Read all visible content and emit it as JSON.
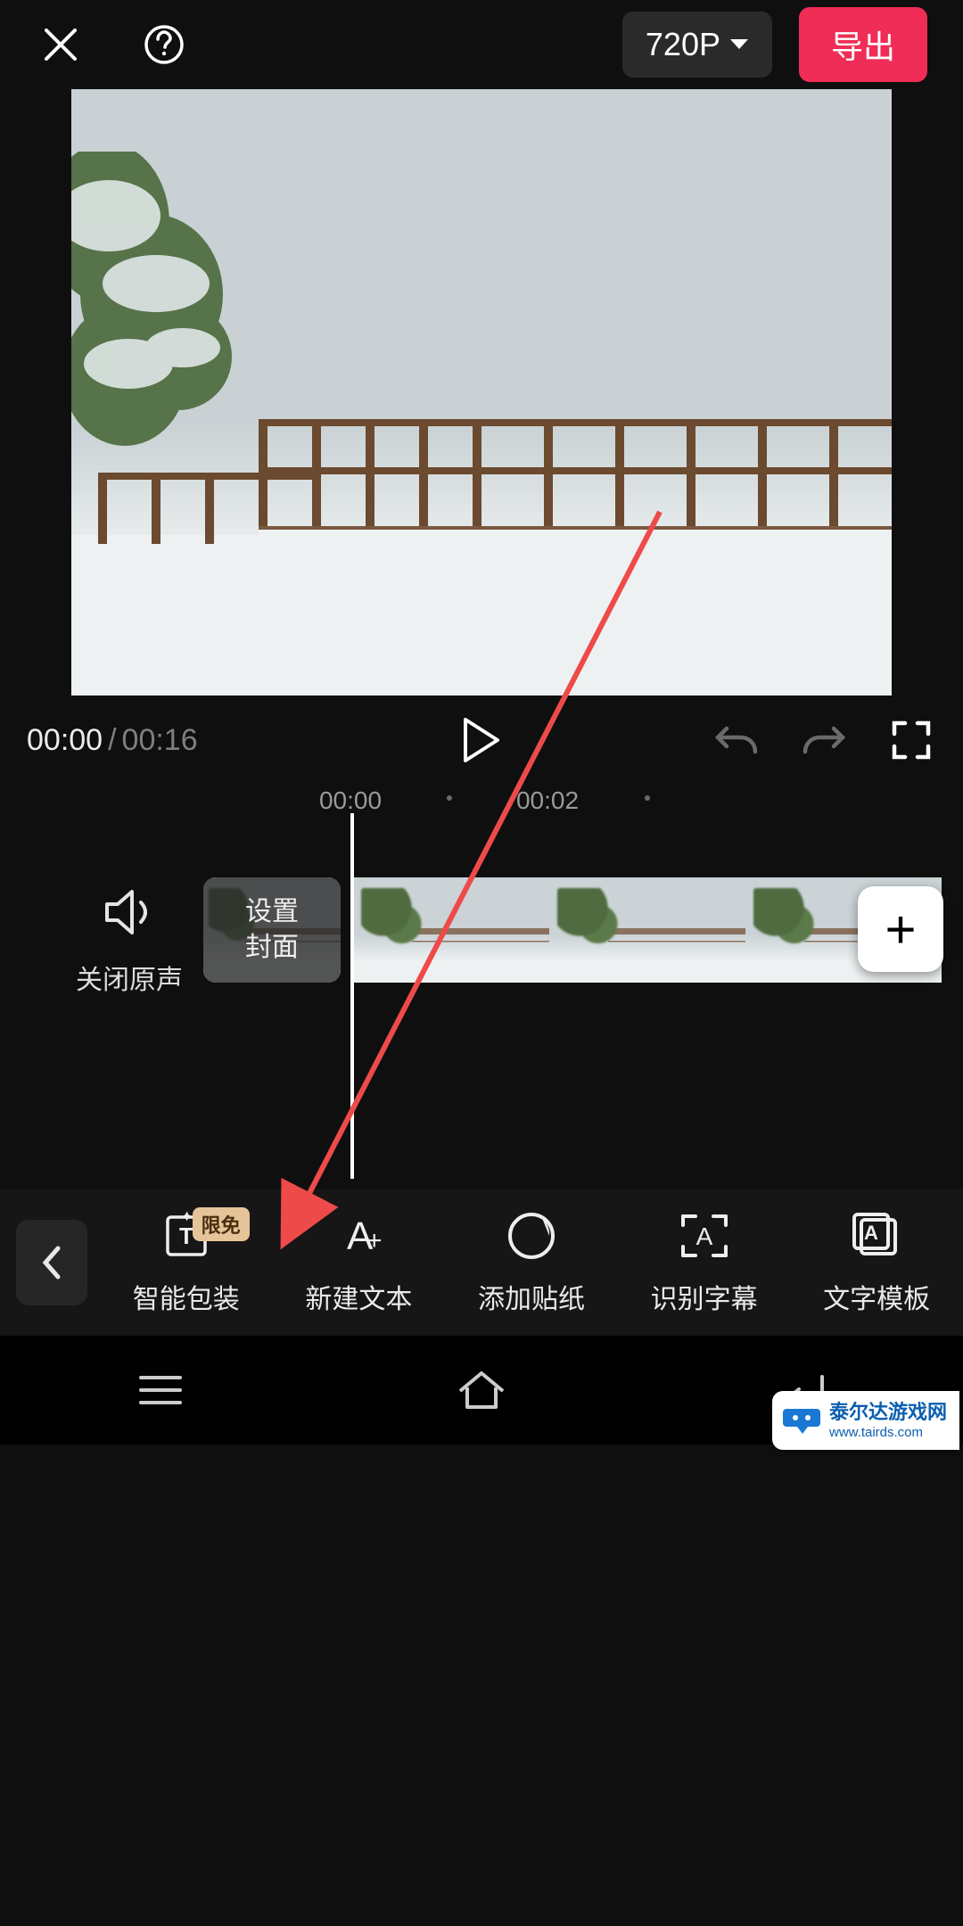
{
  "topbar": {
    "resolution_label": "720P",
    "export_label": "导出"
  },
  "transport": {
    "current_time": "00:00",
    "separator": "/",
    "duration": "00:16"
  },
  "ruler": {
    "ticks": [
      "00:00",
      "00:02"
    ]
  },
  "timeline": {
    "mute_label": "关闭原声",
    "cover_label_line1": "设置",
    "cover_label_line2": "封面",
    "add_label": "+"
  },
  "tools": {
    "back_icon": "chevron-left",
    "items": [
      {
        "label": "智能包装",
        "icon": "smart-pack",
        "badge": "限免"
      },
      {
        "label": "新建文本",
        "icon": "new-text",
        "badge": null
      },
      {
        "label": "添加贴纸",
        "icon": "sticker",
        "badge": null
      },
      {
        "label": "识别字幕",
        "icon": "subtitle",
        "badge": null
      },
      {
        "label": "文字模板",
        "icon": "text-template",
        "badge": null
      }
    ]
  },
  "watermark": {
    "line1": "泰尔达游戏网",
    "line2": "www.tairds.com"
  }
}
